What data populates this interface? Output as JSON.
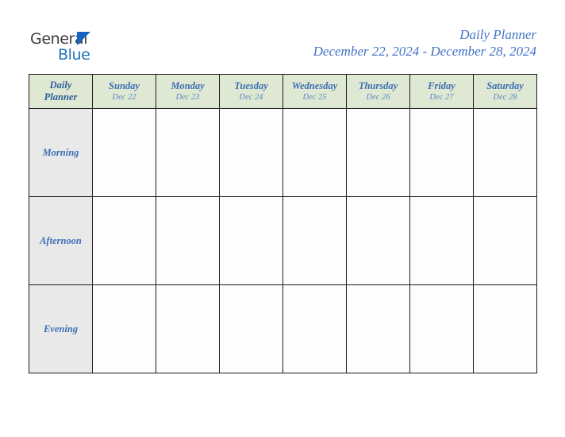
{
  "brand": {
    "word_one": "General",
    "word_two": "Blue",
    "triangle_color": "#1565C0",
    "word_one_color": "#3c3c3c",
    "word_two_color": "#1F72BE"
  },
  "header": {
    "title": "Daily Planner",
    "date_range": "December 22, 2024 - December 28, 2024",
    "title_color": "#4472C4"
  },
  "table": {
    "corner": {
      "line1": "Daily",
      "line2": "Planner"
    },
    "header_bg": "#dfe8d2",
    "row_label_bg": "#e9e9e9",
    "border_color": "#1a1a1a",
    "columns": [
      {
        "day": "Sunday",
        "date": "Dec 22"
      },
      {
        "day": "Monday",
        "date": "Dec 23"
      },
      {
        "day": "Tuesday",
        "date": "Dec 24"
      },
      {
        "day": "Wednesday",
        "date": "Dec 25"
      },
      {
        "day": "Thursday",
        "date": "Dec 26"
      },
      {
        "day": "Friday",
        "date": "Dec 27"
      },
      {
        "day": "Saturday",
        "date": "Dec 28"
      }
    ],
    "rows": [
      {
        "label": "Morning",
        "cells": [
          "",
          "",
          "",
          "",
          "",
          "",
          ""
        ]
      },
      {
        "label": "Afternoon",
        "cells": [
          "",
          "",
          "",
          "",
          "",
          "",
          ""
        ]
      },
      {
        "label": "Evening",
        "cells": [
          "",
          "",
          "",
          "",
          "",
          "",
          ""
        ]
      }
    ]
  }
}
